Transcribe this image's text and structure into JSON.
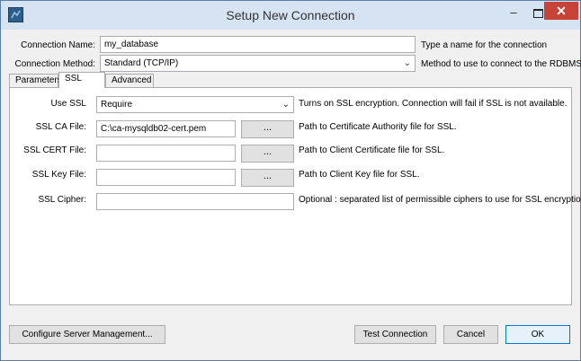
{
  "window": {
    "title": "Setup New Connection"
  },
  "form": {
    "connection_name_label": "Connection Name:",
    "connection_name_value": "my_database",
    "connection_name_hint": "Type a name for the connection",
    "connection_method_label": "Connection Method:",
    "connection_method_value": "Standard (TCP/IP)",
    "connection_method_hint": "Method to use to connect to the RDBMS"
  },
  "tabs": [
    {
      "label": "Parameters"
    },
    {
      "label": "SSL"
    },
    {
      "label": "Advanced"
    }
  ],
  "ssl": {
    "use_ssl_label": "Use SSL",
    "use_ssl_value": "Require",
    "use_ssl_hint": "Turns on SSL encryption. Connection will fail if SSL is not available.",
    "ca_file_label": "SSL CA File:",
    "ca_file_value": "C:\\ca-mysqldb02-cert.pem",
    "ca_file_hint": "Path to Certificate Authority file for SSL.",
    "cert_file_label": "SSL CERT File:",
    "cert_file_value": "",
    "cert_file_hint": "Path to Client Certificate file for SSL.",
    "key_file_label": "SSL Key File:",
    "key_file_value": "",
    "key_file_hint": "Path to Client Key file for SSL.",
    "cipher_label": "SSL Cipher:",
    "cipher_value": "",
    "cipher_hint": "Optional : separated list of permissible ciphers to use for SSL encryption.",
    "browse_label": "..."
  },
  "footer": {
    "configure_label": "Configure Server Management...",
    "test_label": "Test Connection",
    "cancel_label": "Cancel",
    "ok_label": "OK"
  }
}
